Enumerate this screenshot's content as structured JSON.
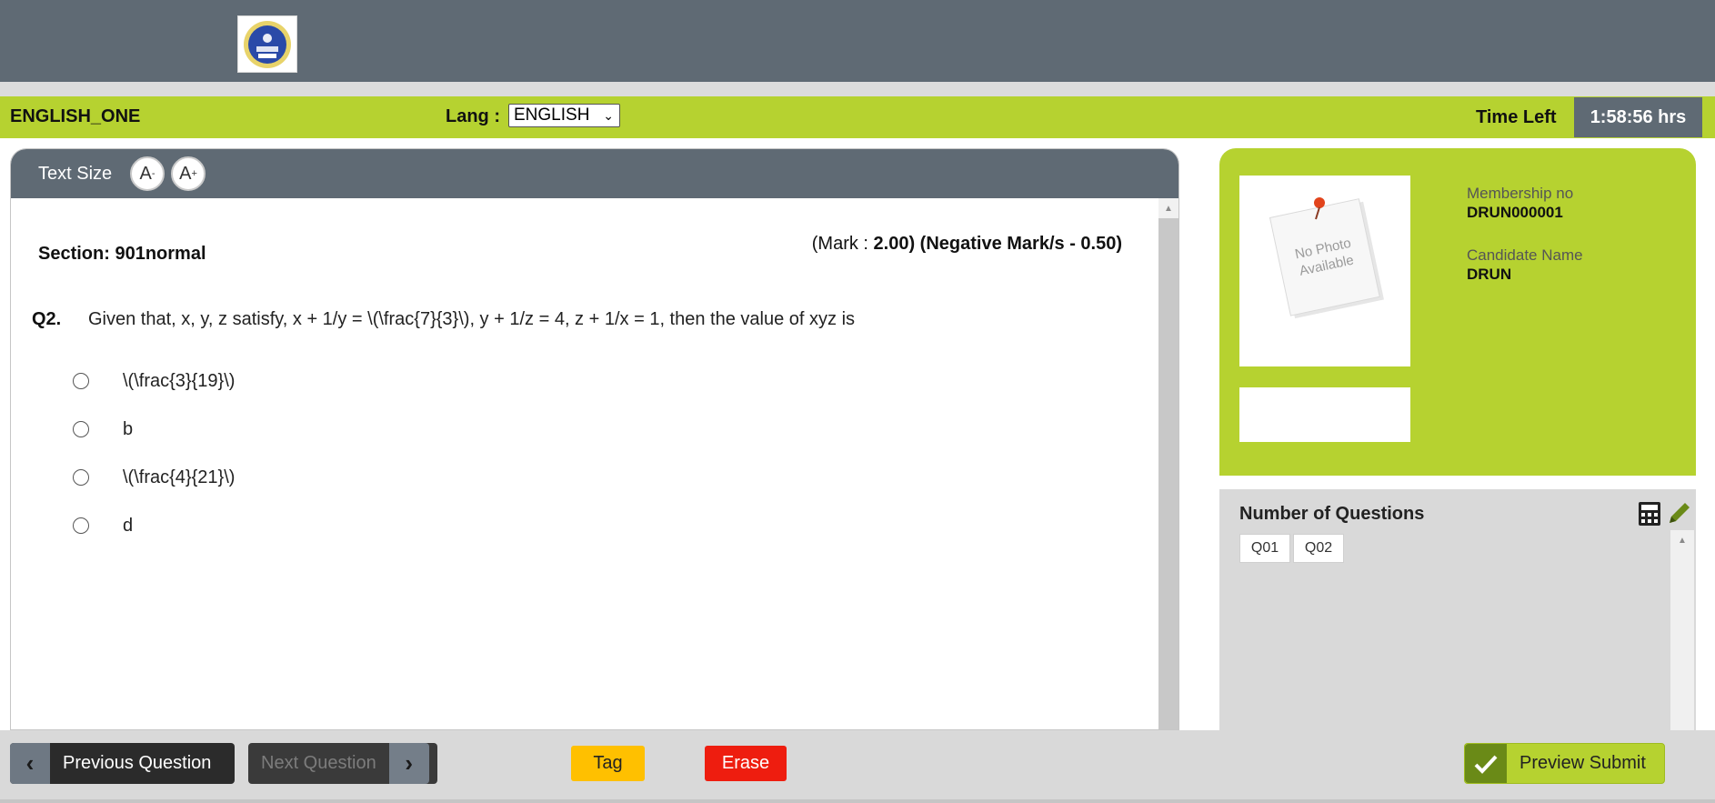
{
  "header": {
    "logo_alt": "DAE",
    "exam_title": "ENGLISH_ONE",
    "lang_label": "Lang :",
    "lang_value": "ENGLISH",
    "time_label": "Time Left",
    "time_value": "1:58:56 hrs"
  },
  "question_panel": {
    "text_size_label": "Text Size",
    "decrease_label": "A",
    "decrease_sup": "-",
    "increase_label": "A",
    "increase_sup": "+",
    "section": "Section: 901normal",
    "mark_prefix": "(Mark : ",
    "mark_value": "2.00",
    "negative_mark": ") (Negative Mark/s - 0.50)",
    "question_number": "Q2.",
    "question_text": "Given that, x, y, z satisfy, x + 1/y = \\(\\frac{7}{3}\\), y + 1/z = 4, z + 1/x = 1, then the value of xyz is",
    "options": [
      {
        "text": "\\(\\frac{3}{19}\\)"
      },
      {
        "text": "b"
      },
      {
        "text": "\\(\\frac{4}{21}\\)"
      },
      {
        "text": "d"
      }
    ]
  },
  "candidate": {
    "photo_text_1": "No Photo",
    "photo_text_2": "Available",
    "membership_label": "Membership no",
    "membership_value": "DRUN000001",
    "name_label": "Candidate Name",
    "name_value": "DRUN"
  },
  "question_nav": {
    "title": "Number of Questions",
    "questions": [
      "Q01",
      "Q02"
    ]
  },
  "footer": {
    "previous_label": "Previous Question",
    "next_label": "Next Question",
    "tag_label": "Tag",
    "erase_label": "Erase",
    "submit_label": "Preview Submit"
  },
  "colors": {
    "header_gray": "#5f6a74",
    "accent_green": "#b6d230",
    "tag_yellow": "#ffc000",
    "erase_red": "#ee1d0f"
  }
}
